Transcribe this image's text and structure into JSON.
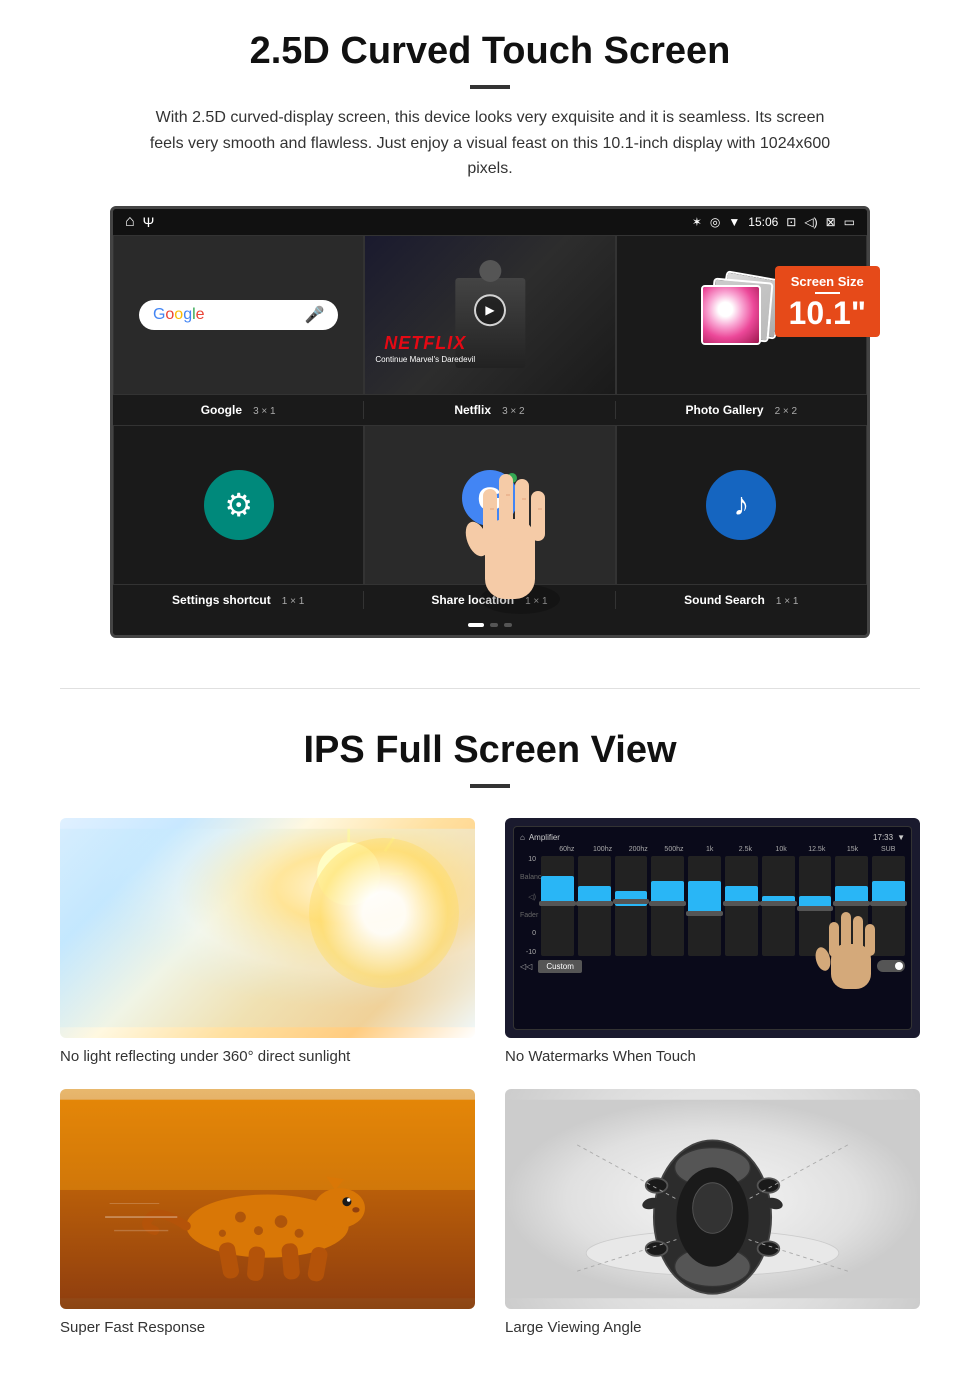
{
  "section1": {
    "title": "2.5D Curved Touch Screen",
    "description": "With 2.5D curved-display screen, this device looks very exquisite and it is seamless. Its screen feels very smooth and flawless. Just enjoy a visual feast on this 10.1-inch display with 1024x600 pixels.",
    "screen_size_badge": {
      "label": "Screen Size",
      "size": "10.1\""
    },
    "status_bar": {
      "time": "15:06"
    },
    "apps": [
      {
        "name": "Google",
        "grid": "3 × 1",
        "type": "google"
      },
      {
        "name": "Netflix",
        "grid": "3 × 2",
        "type": "netflix",
        "subtitle": "Continue Marvel's Daredevil"
      },
      {
        "name": "Photo Gallery",
        "grid": "2 × 2",
        "type": "gallery"
      },
      {
        "name": "Settings shortcut",
        "grid": "1 × 1",
        "type": "settings"
      },
      {
        "name": "Share location",
        "grid": "1 × 1",
        "type": "maps"
      },
      {
        "name": "Sound Search",
        "grid": "1 × 1",
        "type": "sound"
      }
    ]
  },
  "section2": {
    "title": "IPS Full Screen View",
    "features": [
      {
        "id": "sunlight",
        "label": "No light reflecting under 360° direct sunlight",
        "type": "sunlight"
      },
      {
        "id": "watermark",
        "label": "No Watermarks When Touch",
        "type": "amplifier"
      },
      {
        "id": "response",
        "label": "Super Fast Response",
        "type": "cheetah"
      },
      {
        "id": "angle",
        "label": "Large Viewing Angle",
        "type": "car"
      }
    ]
  }
}
